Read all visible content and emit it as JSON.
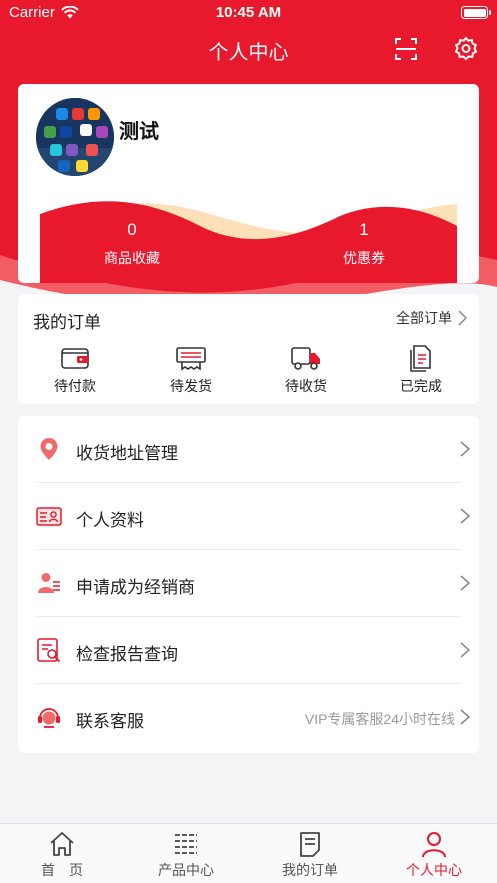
{
  "status_bar": {
    "carrier": "Carrier",
    "time": "10:45 AM"
  },
  "header": {
    "title": "个人中心",
    "scan_icon": "scan-icon",
    "settings_icon": "gear-icon"
  },
  "profile": {
    "username": "测试",
    "stats": [
      {
        "value": "0",
        "label": "商品收藏"
      },
      {
        "value": "1",
        "label": "优惠券"
      }
    ]
  },
  "orders": {
    "title": "我的订单",
    "all_label": "全部订单",
    "items": [
      {
        "label": "待付款",
        "icon": "wallet-icon"
      },
      {
        "label": "待发货",
        "icon": "printer-icon"
      },
      {
        "label": "待收货",
        "icon": "truck-icon"
      },
      {
        "label": "已完成",
        "icon": "document-icon"
      }
    ]
  },
  "menu": [
    {
      "label": "收货地址管理",
      "icon": "location-pin-icon",
      "hint": ""
    },
    {
      "label": "个人资料",
      "icon": "id-card-icon",
      "hint": ""
    },
    {
      "label": "申请成为经销商",
      "icon": "dealer-icon",
      "hint": ""
    },
    {
      "label": "检查报告查询",
      "icon": "report-search-icon",
      "hint": ""
    },
    {
      "label": "联系客服",
      "icon": "headset-icon",
      "hint": "VIP专属客服24小时在线"
    }
  ],
  "tabbar": [
    {
      "label": "首　页",
      "icon": "home-icon",
      "active": false
    },
    {
      "label": "产品中心",
      "icon": "list-icon",
      "active": false
    },
    {
      "label": "我的订单",
      "icon": "order-icon",
      "active": false
    },
    {
      "label": "个人中心",
      "icon": "user-icon",
      "active": true
    }
  ],
  "colors": {
    "brand_red": "#e8182d",
    "wave_cream": "#fbe0b8",
    "background": "#f4f4f6"
  }
}
